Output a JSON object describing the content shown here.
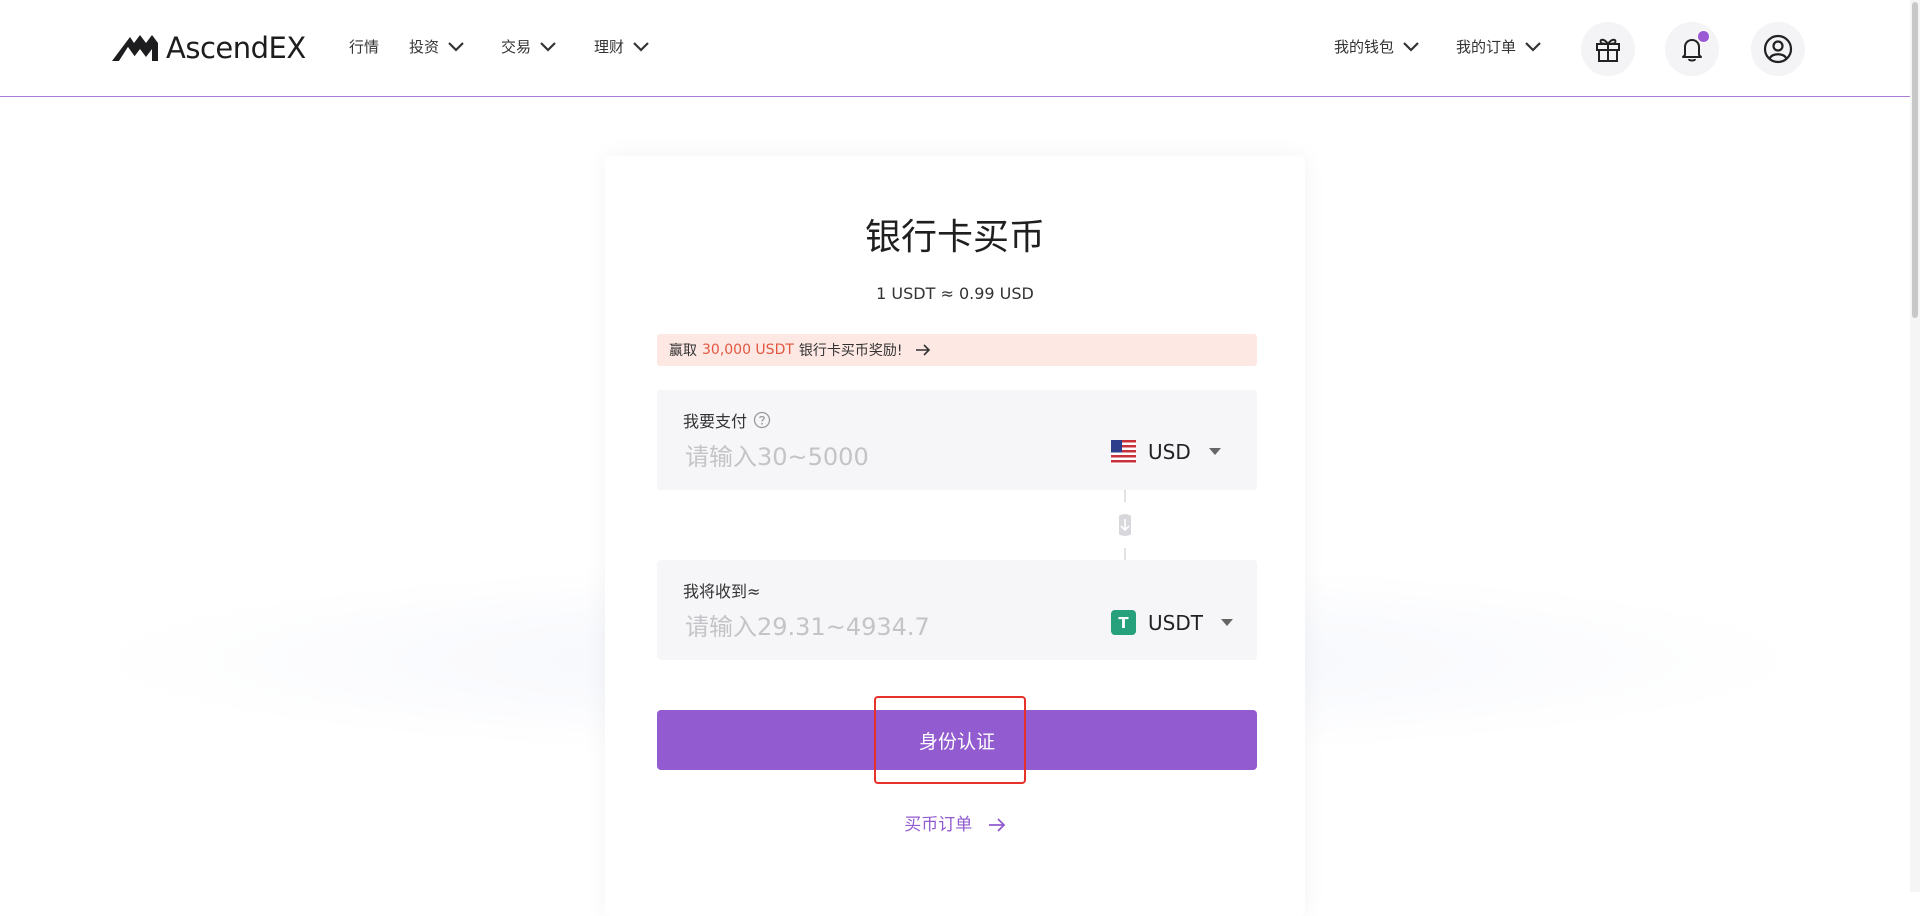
{
  "brand": {
    "name": "AscendEX"
  },
  "nav": {
    "left": [
      {
        "label": "行情",
        "has_dropdown": false
      },
      {
        "label": "投资",
        "has_dropdown": true
      },
      {
        "label": "交易",
        "has_dropdown": true
      },
      {
        "label": "理财",
        "has_dropdown": true
      }
    ],
    "right": [
      {
        "label": "我的钱包",
        "has_dropdown": true
      },
      {
        "label": "我的订单",
        "has_dropdown": true
      }
    ],
    "icons": [
      "gift-icon",
      "bell-icon",
      "user-icon"
    ],
    "notification_dot": true
  },
  "card": {
    "title": "银行卡买币",
    "rate": "1 USDT ≈ 0.99 USD",
    "promo": {
      "prefix": "赢取",
      "highlight": "30,000 USDT",
      "suffix": "银行卡买币奖励!"
    },
    "pay": {
      "label": "我要支付",
      "placeholder": "请输入30~5000",
      "currency": "USD",
      "currency_icon": "us-flag-icon"
    },
    "receive": {
      "label": "我将收到≈",
      "placeholder": "请输入29.31~4934.7",
      "currency": "USDT",
      "currency_icon": "tether-icon",
      "currency_glyph": "T"
    },
    "submit_label": "身份认证",
    "orders_link": "买币订单"
  },
  "colors": {
    "accent": "#925bcf",
    "promo_bg": "#fde8e4",
    "promo_highlight": "#e2573f",
    "tether": "#26a17b",
    "annotation_box": "#e8302a"
  }
}
